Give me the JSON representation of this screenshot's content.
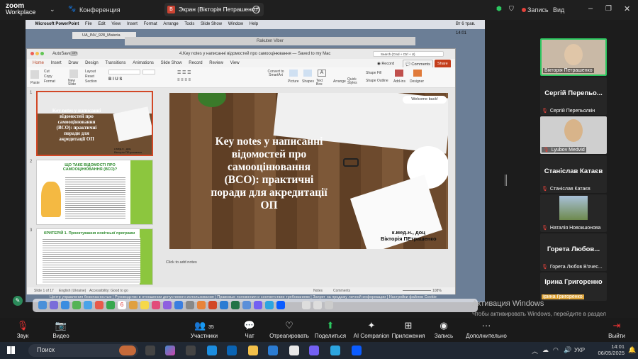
{
  "zoom": {
    "logo_top": "zoom",
    "logo_bottom": "Workplace",
    "conference": "Конференция",
    "screen_share": "Экран (Вікторія Петрашенко)",
    "screen_badge": "В",
    "record": "Запись",
    "view": "Вид"
  },
  "mac": {
    "app": "Microsoft PowerPoint",
    "menu": [
      "File",
      "Edit",
      "View",
      "Insert",
      "Format",
      "Arrange",
      "Tools",
      "Slide Show",
      "Window",
      "Help"
    ],
    "clock": "Вт 6 трав. 14:01",
    "back_window": "UA_INV_928_Materia",
    "viber_title": "Rakuten Viber"
  },
  "ppt": {
    "autosave": "AutoSave",
    "autosave_state": "OFF",
    "doc_title": "4.Key notes у написанні відомостей про самооцінювання — Saved to my Mac",
    "search": "Search (Cmd + Ctrl + U)",
    "tabs": [
      "Home",
      "Insert",
      "Draw",
      "Design",
      "Transitions",
      "Animations",
      "Slide Show",
      "Record",
      "Review",
      "View"
    ],
    "record_btn": "Record",
    "comments_btn": "Comments",
    "share_btn": "Share",
    "ribbon": {
      "paste": "Paste",
      "cut": "Cut",
      "copy": "Copy",
      "format": "Format",
      "new_slide": "New Slide",
      "layout": "Layout",
      "reset": "Reset",
      "section": "Section",
      "smartart": "Convert to SmartArt",
      "picture": "Picture",
      "shapes": "Shapes",
      "textbox": "Text Box",
      "arrange": "Arrange",
      "quick_styles": "Quick Styles",
      "shape_fill": "Shape Fill",
      "shape_outline": "Shape Outline",
      "addins": "Add-ins",
      "designer": "Designer"
    },
    "slide_title": "Key notes у написанні відомостей про самооцінювання (ВСО): практичні поради для акредитації ОП",
    "slide_author": "к.мед.н., доц\nВікторія ПЕтрашенко",
    "welcome": "Welcome back!",
    "notes_hint": "Click to add notes",
    "status_left": "Slide 1 of 17",
    "language": "English (Ukraine)",
    "accessibility": "Accessibility: Good to go",
    "notes": "Notes",
    "comments": "Comments",
    "zoom_level": "108%",
    "thumb2_title": "ЩО ТАКЕ ВІДОМОСТІ ПРО САМООЦІНЮВАННЯ (ВСО)?",
    "thumb3_title": "КРИТЕРІЙ 1. Проектування освітньої програми",
    "thumb1_title": "Key notes у написанні відомостей про самооцінювання (ВСО): практичні поради для акредитації ОП",
    "thumb1_author": "к.мед.н., доц\nВікторія ПЕтрашенко"
  },
  "footer": {
    "copyright": "©2025 Zoom Communications, Inc. Все права защищены.",
    "links": "Центр управления безопасностью | Руководство в отношении допустимого использования | Правовые положения и соответствие требованиям | Запрет на продажу личной информации | Настройки файлов Cookie"
  },
  "participants": [
    {
      "type": "video",
      "name": "Вікторія Петрашенко",
      "muted": false
    },
    {
      "type": "name",
      "big": "Сергій Перепьо...",
      "name": "Сергій Перепьолкін",
      "muted": true
    },
    {
      "type": "video",
      "name": "Lyubov Medvid",
      "muted": true
    },
    {
      "type": "name",
      "big": "Станіслав Катаєв",
      "name": "Станіслав Катаєв",
      "muted": true
    },
    {
      "type": "video",
      "name": "Наталія Новокшонова",
      "muted": true
    },
    {
      "type": "name",
      "big": "Горета Любов...",
      "name": "Горета Любов В'ячес...",
      "muted": true
    },
    {
      "type": "name",
      "big": "Ірина Григоренко",
      "name": "Ірина Григоренко",
      "muted": false
    }
  ],
  "activation": {
    "title": "Активация Windows",
    "text": "Чтобы активировать Windows, перейдите в раздел \"Параметры\"."
  },
  "toolbar": [
    {
      "key": "audio",
      "label": "Звук",
      "icon": "🎙"
    },
    {
      "key": "video",
      "label": "Видео",
      "icon": "📷"
    },
    {
      "key": "participants",
      "label": "Участники",
      "icon": "👥",
      "count": "35"
    },
    {
      "key": "chat",
      "label": "Чат",
      "icon": "💬"
    },
    {
      "key": "react",
      "label": "Отреагировать",
      "icon": "♡"
    },
    {
      "key": "share",
      "label": "Поделиться",
      "icon": "⬆"
    },
    {
      "key": "ai",
      "label": "AI Companion",
      "icon": "✦"
    },
    {
      "key": "apps",
      "label": "Приложения",
      "icon": "⊞"
    },
    {
      "key": "record",
      "label": "Запись",
      "icon": "◉"
    },
    {
      "key": "more",
      "label": "Дополнительно",
      "icon": "···"
    },
    {
      "key": "end",
      "label": "Выйти",
      "icon": "⇥"
    }
  ],
  "taskbar": {
    "search": "Поиск",
    "lang": "УКР",
    "time": "14:01",
    "date": "06/05/2025"
  },
  "colors": {
    "accent": "#0e72ed",
    "end": "#e3423b",
    "ppt_accent": "#b7472a",
    "thumb_green": "#7fb13a"
  }
}
